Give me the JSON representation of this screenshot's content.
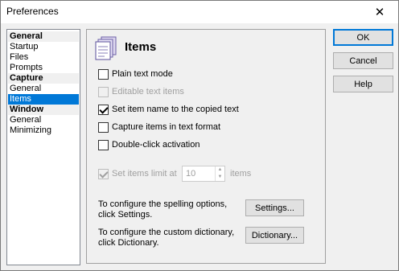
{
  "window": {
    "title": "Preferences",
    "close_glyph": "✕"
  },
  "nav": [
    {
      "label": "General",
      "type": "header"
    },
    {
      "label": "Startup",
      "type": "sub"
    },
    {
      "label": "Files",
      "type": "sub"
    },
    {
      "label": "Prompts",
      "type": "sub"
    },
    {
      "label": "Capture",
      "type": "header"
    },
    {
      "label": "General",
      "type": "sub"
    },
    {
      "label": "Items",
      "type": "sub",
      "selected": true
    },
    {
      "label": "Window",
      "type": "header"
    },
    {
      "label": "General",
      "type": "sub"
    },
    {
      "label": "Minimizing",
      "type": "sub"
    }
  ],
  "page": {
    "title": "Items",
    "icon": "documents-icon"
  },
  "options": {
    "plain_text_mode": {
      "label": "Plain text mode",
      "checked": false,
      "enabled": true
    },
    "editable_text_items": {
      "label": "Editable text items",
      "checked": false,
      "enabled": false
    },
    "set_item_name": {
      "label": "Set item name to the copied text",
      "checked": true,
      "enabled": true
    },
    "capture_text_format": {
      "label": "Capture items in text format",
      "checked": false,
      "enabled": true
    },
    "double_click": {
      "label": "Double-click activation",
      "checked": false,
      "enabled": true
    },
    "set_items_limit": {
      "label": "Set items limit at",
      "checked": true,
      "enabled": false
    }
  },
  "limit": {
    "value": "10",
    "unit": "items"
  },
  "spelling": {
    "line1": "To configure the spelling options,",
    "line2": "click Settings.",
    "button": "Settings..."
  },
  "dictionary": {
    "line1": "To configure the custom dictionary,",
    "line2": "click Dictionary.",
    "button": "Dictionary..."
  },
  "buttons": {
    "ok": "OK",
    "cancel": "Cancel",
    "help": "Help"
  },
  "colors": {
    "selection": "#0078d7",
    "face": "#f0f0f0",
    "disabled_text": "#a0a0a0"
  }
}
